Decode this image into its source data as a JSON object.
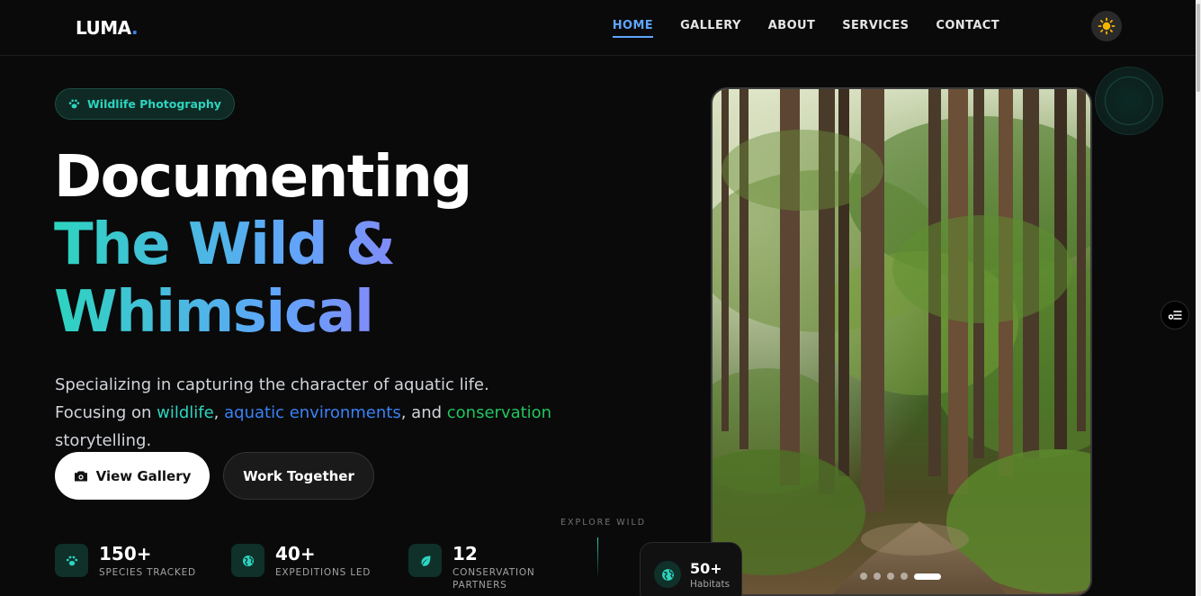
{
  "header": {
    "logo_text": "LUMA",
    "logo_dot": ".",
    "nav": [
      {
        "label": "HOME",
        "active": true
      },
      {
        "label": "GALLERY",
        "active": false
      },
      {
        "label": "ABOUT",
        "active": false
      },
      {
        "label": "SERVICES",
        "active": false
      },
      {
        "label": "CONTACT",
        "active": false
      }
    ],
    "theme_icon": "sun-icon"
  },
  "hero": {
    "badge": {
      "icon": "paw-icon",
      "label": "Wildlife Photography"
    },
    "title_line1": "Documenting",
    "title_line2": "The Wild &",
    "title_line3": "Whimsical",
    "subtitle_part1": "Specializing in capturing the character of aquatic life. Focusing on ",
    "subtitle_hl1": "wildlife",
    "subtitle_sep1": ", ",
    "subtitle_hl2": "aquatic environments",
    "subtitle_sep2": ", and ",
    "subtitle_hl3": "conservation",
    "subtitle_end": " storytelling.",
    "primary_button": {
      "icon": "camera-icon",
      "label": "View Gallery"
    },
    "secondary_button": {
      "label": "Work Together"
    }
  },
  "stats": [
    {
      "icon": "paw-icon",
      "value": "150+",
      "label": "SPECIES TRACKED"
    },
    {
      "icon": "globe-icon",
      "value": "40+",
      "label": "EXPEDITIONS LED"
    },
    {
      "icon": "leaf-icon",
      "value": "12",
      "label_line1": "CONSERVATION",
      "label_line2": "PARTNERS"
    }
  ],
  "explore": {
    "label": "EXPLORE WILD"
  },
  "gallery_card": {
    "slides_total": 5,
    "active_slide": 5,
    "habitats": {
      "icon": "globe-icon",
      "value": "50+",
      "label": "Habitats"
    }
  },
  "colors": {
    "background": "#0a0a0a",
    "accent_teal": "#2dd4bf",
    "accent_blue": "#3b82f6",
    "accent_green": "#22c55e",
    "nav_active": "#60a5fa",
    "sun": "#f5b400"
  }
}
